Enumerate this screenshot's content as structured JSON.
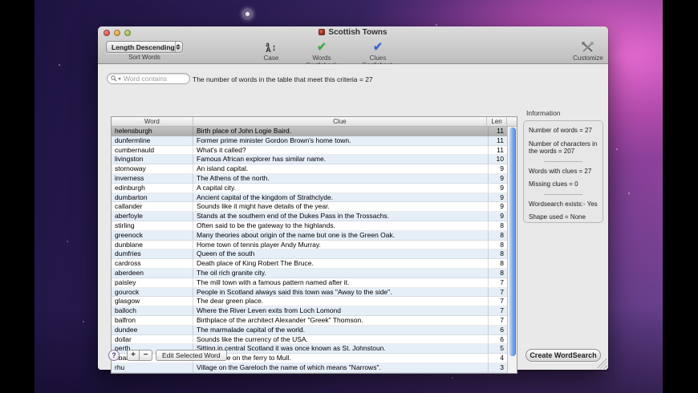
{
  "window": {
    "title": "Scottish Towns"
  },
  "toolbar": {
    "sort_popup": {
      "value": "Length Descending",
      "label": "Sort Words"
    },
    "case_button": {
      "label": "Case",
      "glyph_small": "a",
      "glyph_large": "A",
      "glyph_arrow": "↕"
    },
    "words_spellcheck": {
      "icon": "green-checkmark",
      "check_glyph": "✔",
      "label_line1": "Words",
      "label_line2": "Spellcheck"
    },
    "clues_spellcheck": {
      "icon": "blue-checkmark",
      "check_glyph": "✔",
      "label_line1": "Clues",
      "label_line2": "Spellcheck"
    },
    "customize": {
      "icon": "crossed-tools",
      "label": "Customize"
    }
  },
  "filter": {
    "search_placeholder": "Word contains",
    "criteria_text": "The number of words in the table that meet this criteria = 27"
  },
  "table": {
    "columns": [
      "Word",
      "Clue",
      "Len"
    ],
    "selected_index": 0,
    "rows": [
      {
        "word": "helensburgh",
        "clue": "Birth place of John Logie Baird.",
        "len": 11
      },
      {
        "word": "dunfermline",
        "clue": "Former prime minister Gordon Brown's home town.",
        "len": 11
      },
      {
        "word": "cumbernauld",
        "clue": "What's it called?",
        "len": 11
      },
      {
        "word": "livingston",
        "clue": "Famous African explorer has similar name.",
        "len": 10
      },
      {
        "word": "stornoway",
        "clue": "An island capital.",
        "len": 9
      },
      {
        "word": "inverness",
        "clue": "The Athens of the north.",
        "len": 9
      },
      {
        "word": "edinburgh",
        "clue": "A capital city.",
        "len": 9
      },
      {
        "word": "dumbarton",
        "clue": "Ancient capital of the kingdom of Strathclyde.",
        "len": 9
      },
      {
        "word": "callander",
        "clue": "Sounds like it might have details of the year.",
        "len": 9
      },
      {
        "word": "aberfoyle",
        "clue": "Stands at the southern end of the Dukes Pass in the Trossachs.",
        "len": 9
      },
      {
        "word": "stirling",
        "clue": "Often said to be the gateway to the highlands.",
        "len": 8
      },
      {
        "word": "greenock",
        "clue": "Many theories about origin of the name but one is the Green Oak.",
        "len": 8
      },
      {
        "word": "dunblane",
        "clue": "Home town of tennis player Andy Murray.",
        "len": 8
      },
      {
        "word": "dumfries",
        "clue": "Queen of the south",
        "len": 8
      },
      {
        "word": "cardross",
        "clue": "Death place of King Robert The Bruce.",
        "len": 8
      },
      {
        "word": "aberdeen",
        "clue": "The oil rich granite city.",
        "len": 8
      },
      {
        "word": "paisley",
        "clue": "The mill town with a famous pattern named after it.",
        "len": 7
      },
      {
        "word": "gourock",
        "clue": "People in Scotland always said this town was \"Away to the side\".",
        "len": 7
      },
      {
        "word": "glasgow",
        "clue": "The dear green place.",
        "len": 7
      },
      {
        "word": "balloch",
        "clue": "Where the River Leven exits from Loch Lomond",
        "len": 7
      },
      {
        "word": "balfron",
        "clue": "Birthplace of the architect Alexander \"Greek\" Thomson.",
        "len": 7
      },
      {
        "word": "dundee",
        "clue": "The marmalade capital of the world.",
        "len": 6
      },
      {
        "word": "dollar",
        "clue": "Sounds like the currency of the USA.",
        "len": 6
      },
      {
        "word": "perth",
        "clue": "Sitting in central Scotland it was once known as St. Johnstoun.",
        "len": 5
      },
      {
        "word": "oban",
        "clue": "Leave here on the ferry to Mull.",
        "len": 4
      },
      {
        "word": "rhu",
        "clue": "Village on the Gareloch the name of which means \"Narrows\".",
        "len": 3
      }
    ]
  },
  "info_panel": {
    "title": "Information",
    "lines": [
      "Number of words = 27",
      "Number of characters in the words = 207",
      "Words with clues = 27",
      "Missing clues = 0",
      "Wordsearch exists:- Yes",
      "Shape used =   None"
    ]
  },
  "footer": {
    "help_label": "?",
    "add_label": "+",
    "remove_label": "−",
    "edit_button": "Edit Selected Word",
    "create_button": "Create WordSearch"
  },
  "colors": {
    "accent_selection": "#b5b5b5",
    "alt_row": "#e6eef8",
    "scrollbar_blue": "#5a8fe0",
    "check_green": "#2faf3a",
    "check_blue": "#2f62d8",
    "wallpaper_pink": "#e068d0",
    "wallpaper_purple": "#3c2766"
  }
}
